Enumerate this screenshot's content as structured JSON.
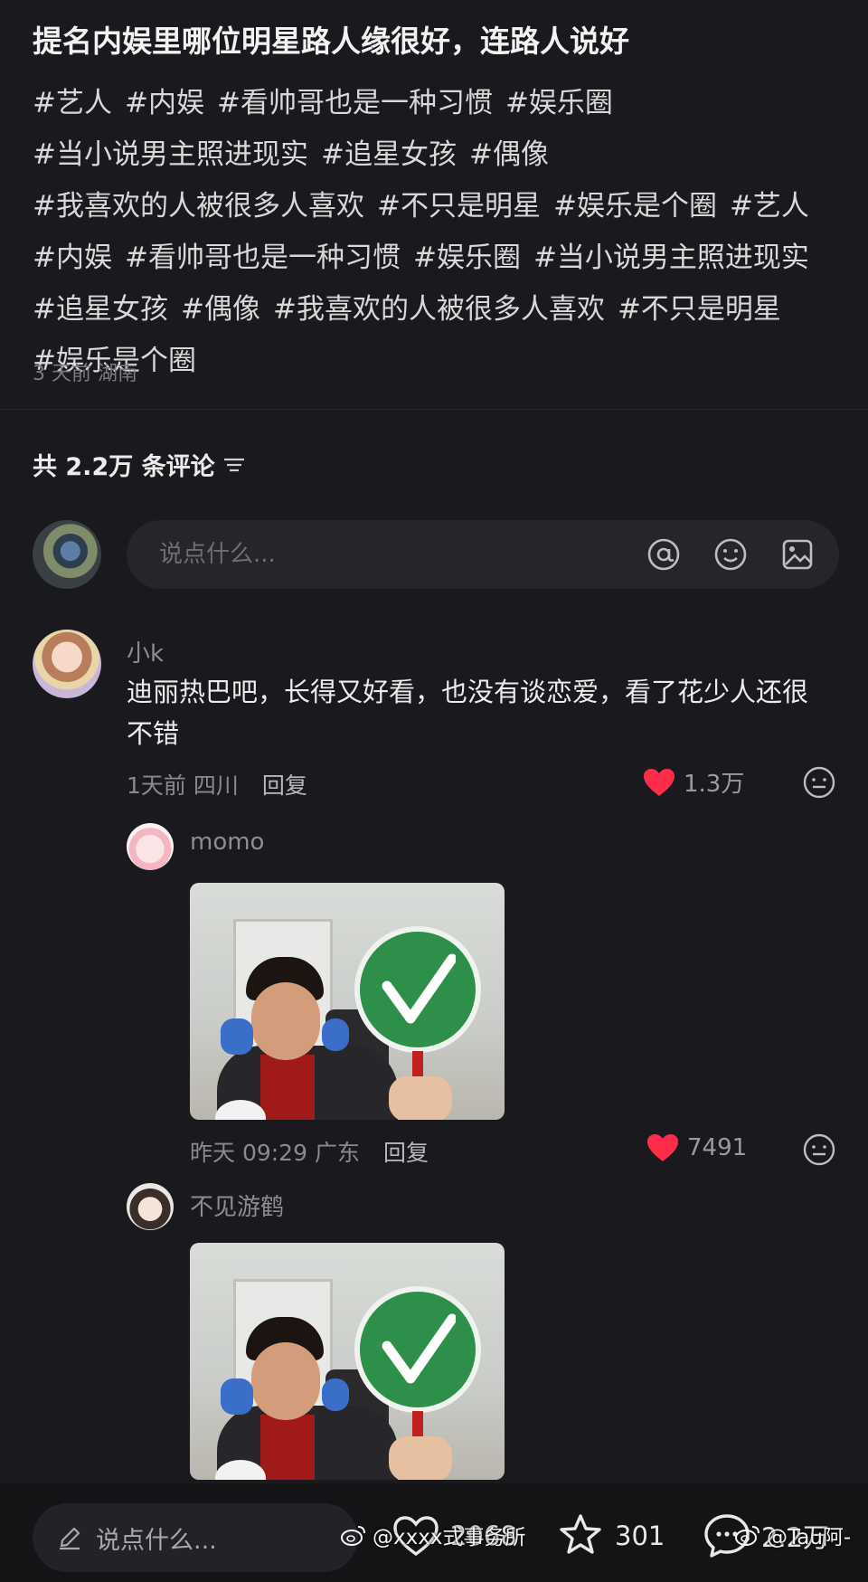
{
  "post": {
    "title": "提名内娱里哪位明星路人缘很好，连路人说好",
    "hashtags": [
      "#艺人",
      "#内娱",
      "#看帅哥也是一种习惯",
      "#娱乐圈",
      "#当小说男主照进现实",
      "#追星女孩",
      "#偶像",
      "#我喜欢的人被很多人喜欢",
      "#不只是明星",
      "#娱乐是个圈",
      "#艺人",
      "#内娱",
      "#看帅哥也是一种习惯",
      "#娱乐圈",
      "#当小说男主照进现实",
      "#追星女孩",
      "#偶像",
      "#我喜欢的人被很多人喜欢",
      "#不只是明星",
      "#娱乐是个圈"
    ],
    "meta": "3 天前 湖南"
  },
  "comments_header": {
    "label": "共 2.2万 条评论",
    "sort_icon": "sort-icon"
  },
  "compose": {
    "placeholder": "说点什么...",
    "icons": [
      "at-icon",
      "emoji-icon",
      "image-icon"
    ]
  },
  "comments": [
    {
      "username": "小k",
      "text": "迪丽热巴吧，长得又好看，也没有谈恋爱，看了花少人还很不错",
      "time": "1天前",
      "location": "四川",
      "reply_label": "回复",
      "likes": "1.3万"
    },
    {
      "username": "momo",
      "time": "昨天 09:29",
      "location": "广东",
      "reply_label": "回复",
      "likes": "7491"
    },
    {
      "username": "不见游鹤"
    }
  ],
  "bottom_bar": {
    "placeholder": "说点什么...",
    "likes": "2068",
    "favorites": "301",
    "comments": "2.2万"
  },
  "watermarks": [
    "@xxxx式事务所",
    "@Tau阿-"
  ],
  "colors": {
    "background": "#1a1a1e",
    "like_red": "#ff2d4a",
    "sign_green": "#2e8f4a"
  }
}
